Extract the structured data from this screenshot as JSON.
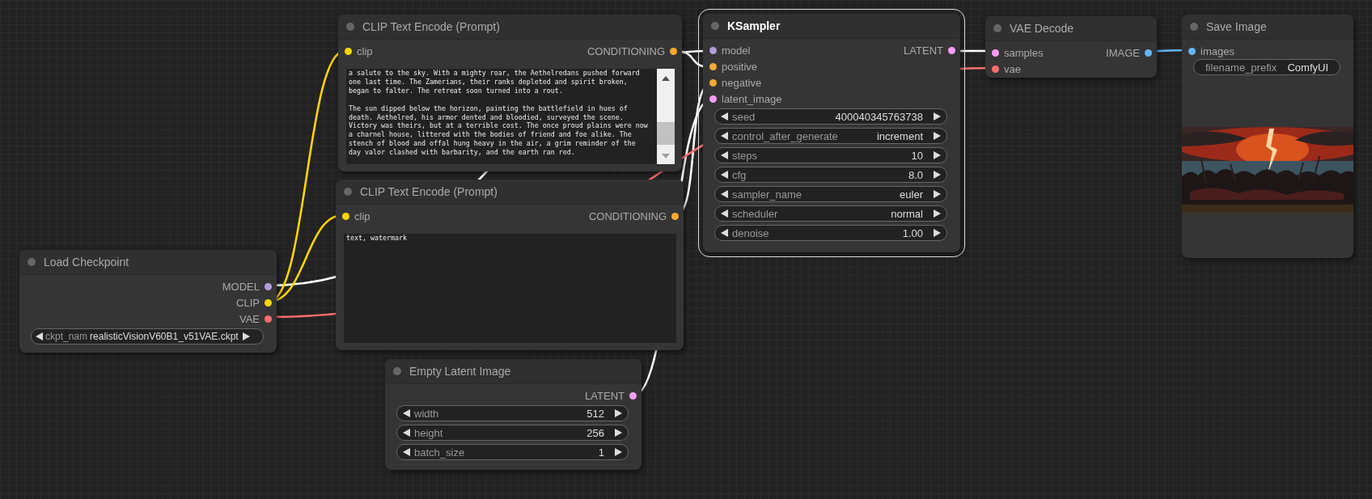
{
  "nodes": [
    {
      "title": "Load Checkpoint",
      "selected": false,
      "outputs": [
        {
          "label": "MODEL",
          "color": "#b39ddb"
        },
        {
          "label": "CLIP",
          "color": "#ffd500"
        },
        {
          "label": "VAE",
          "color": "#ff6e6e"
        }
      ],
      "widgets": [
        {
          "kind": "stepper",
          "label": "ckpt_nam",
          "value": "realisticVisionV60B1_v51VAE.ckpt"
        }
      ]
    },
    {
      "title": "CLIP Text Encode (Prompt)",
      "selected": false,
      "inputs": [
        {
          "label": "clip",
          "color": "#ffd500"
        }
      ],
      "outputs": [
        {
          "label": "CONDITIONING",
          "color": "#ffa931"
        }
      ],
      "prompt": "a salute to the sky. With a mighty roar, the Aethelredans pushed forward one last time. The Zamerians, their ranks depleted and spirit broken, began to falter. The retreat soon turned into a rout.\n\nThe sun dipped below the horizon, painting the battlefield in hues of death. Aethelred, his armor dented and bloodied, surveyed the scene. Victory was theirs, but at a terrible cost. The once proud plains were now a charnel house, littered with the bodies of friend and foe alike. The stench of blood and offal hung heavy in the air, a grim reminder of the day valor clashed with barbarity, and the earth ran red."
    },
    {
      "title": "CLIP Text Encode (Prompt)",
      "selected": false,
      "inputs": [
        {
          "label": "clip",
          "color": "#ffd500"
        }
      ],
      "outputs": [
        {
          "label": "CONDITIONING",
          "color": "#ffa931"
        }
      ],
      "prompt": "text, watermark"
    },
    {
      "title": "Empty Latent Image",
      "selected": false,
      "outputs": [
        {
          "label": "LATENT",
          "color": "#ff9cf9"
        }
      ],
      "widgets": [
        {
          "kind": "stepper",
          "label": "width",
          "value": "512"
        },
        {
          "kind": "stepper",
          "label": "height",
          "value": "256"
        },
        {
          "kind": "stepper",
          "label": "batch_size",
          "value": "1"
        }
      ]
    },
    {
      "title": "KSampler",
      "selected": true,
      "inputs": [
        {
          "label": "model",
          "color": "#b39ddb"
        },
        {
          "label": "positive",
          "color": "#ffa931"
        },
        {
          "label": "negative",
          "color": "#ffa931"
        },
        {
          "label": "latent_image",
          "color": "#ff9cf9"
        }
      ],
      "outputs": [
        {
          "label": "LATENT",
          "color": "#ff9cf9"
        }
      ],
      "widgets": [
        {
          "kind": "stepper",
          "label": "seed",
          "value": "400040345763738"
        },
        {
          "kind": "stepper",
          "label": "control_after_generate",
          "value": "increment"
        },
        {
          "kind": "stepper",
          "label": "steps",
          "value": "10"
        },
        {
          "kind": "stepper",
          "label": "cfg",
          "value": "8.0"
        },
        {
          "kind": "stepper",
          "label": "sampler_name",
          "value": "euler"
        },
        {
          "kind": "stepper",
          "label": "scheduler",
          "value": "normal"
        },
        {
          "kind": "stepper",
          "label": "denoise",
          "value": "1.00"
        }
      ]
    },
    {
      "title": "VAE Decode",
      "selected": false,
      "inputs": [
        {
          "label": "samples",
          "color": "#ff9cf9"
        },
        {
          "label": "vae",
          "color": "#ff6e6e"
        }
      ],
      "outputs": [
        {
          "label": "IMAGE",
          "color": "#64b5f6"
        }
      ]
    },
    {
      "title": "Save Image",
      "selected": false,
      "inputs": [
        {
          "label": "images",
          "color": "#64b5f6"
        }
      ],
      "widgets": [
        {
          "kind": "text",
          "label": "filename_prefix",
          "value": "ComfyUI"
        }
      ],
      "preview": {
        "kind": "picture"
      }
    }
  ]
}
